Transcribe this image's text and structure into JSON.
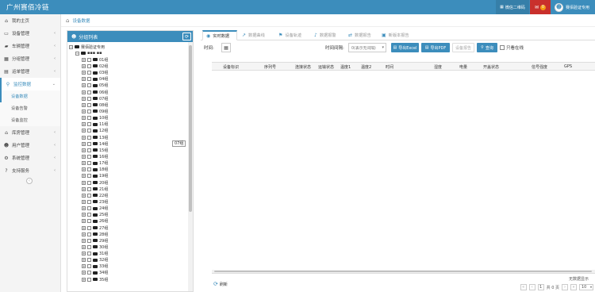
{
  "topbar": {
    "brand": "广州赛佰冷链",
    "qr_label": "微信二维码",
    "chat_badge": "0",
    "user_name": "赛佰验证专用"
  },
  "sidebar": {
    "items": [
      {
        "label": "我的主页",
        "icon": "home-icon",
        "glyph": "⌂",
        "chevron": false
      },
      {
        "label": "设备管理",
        "icon": "device-icon",
        "glyph": "▭",
        "chevron": true
      },
      {
        "label": "车辆管理",
        "icon": "truck-icon",
        "glyph": "▰",
        "chevron": true
      },
      {
        "label": "分组管理",
        "icon": "group-icon",
        "glyph": "▦",
        "chevron": true
      },
      {
        "label": "运单管理",
        "icon": "waybill-icon",
        "glyph": "▤",
        "chevron": true
      },
      {
        "label": "监控数据",
        "icon": "search-icon",
        "glyph": "⚲",
        "chevron": true,
        "active": true
      }
    ],
    "sub_items": [
      "设备数据",
      "设备告警",
      "设备监控"
    ],
    "items_after": [
      {
        "label": "库房管理",
        "icon": "warehouse-icon",
        "glyph": "⌂",
        "chevron": true
      },
      {
        "label": "用户管理",
        "icon": "user-icon",
        "glyph": "☻",
        "chevron": true
      },
      {
        "label": "系统管理",
        "icon": "gear-icon",
        "glyph": "⚙",
        "chevron": true
      },
      {
        "label": "支持服务",
        "icon": "help-icon",
        "glyph": "?",
        "chevron": true
      }
    ],
    "collapse_glyph": "‹"
  },
  "breadcrumb": {
    "label": "设备数据"
  },
  "group_panel": {
    "title": "分组列表",
    "root_label": "赛佰验证专用",
    "sub_label": "▪▪▪ ▪▪",
    "groups": [
      "01组",
      "02组",
      "03组",
      "04组",
      "05组",
      "06组",
      "07组",
      "08组",
      "09组",
      "10组",
      "11组",
      "12组",
      "13组",
      "14组",
      "15组",
      "16组",
      "17组",
      "18组",
      "19组",
      "20组",
      "21组",
      "22组",
      "23组",
      "24组",
      "25组",
      "26组",
      "27组",
      "28组",
      "29组",
      "30组",
      "31组",
      "32组",
      "33组",
      "34组",
      "35组"
    ],
    "tooltip": "07组"
  },
  "tabs": [
    {
      "label": "实时数据",
      "icon": "realtime-icon",
      "glyph": "◉",
      "active": true
    },
    {
      "label": "数据曲线",
      "icon": "chart-line-icon",
      "glyph": "↗"
    },
    {
      "label": "设备轨迹",
      "icon": "flag-icon",
      "glyph": "⚑"
    },
    {
      "label": "数据报警",
      "icon": "bell-icon",
      "glyph": "♪"
    },
    {
      "label": "数据报告",
      "icon": "report-icon",
      "glyph": "⇄"
    },
    {
      "label": "新版本报告",
      "icon": "doc-icon",
      "glyph": "▣"
    }
  ],
  "filters": {
    "time_label": "时间:",
    "interval_label": "时间间隔:",
    "interval_value": "0(表示无间隔)",
    "export_excel": "导出Excel",
    "export_pdf": "导出PDF",
    "device_report": "设备报告",
    "query": "查询",
    "online_only": "只看在线"
  },
  "table": {
    "columns": [
      "设备标识",
      "序列号",
      "连接状态",
      "运输状态",
      "温度1",
      "温度2",
      "时间",
      "湿度",
      "电量",
      "开盖状态",
      "信号强度",
      "GPS"
    ]
  },
  "footer": {
    "refresh": "刷新",
    "no_data": "无数据显示",
    "total": "共 0 页",
    "page": "1",
    "page_size": "10"
  }
}
